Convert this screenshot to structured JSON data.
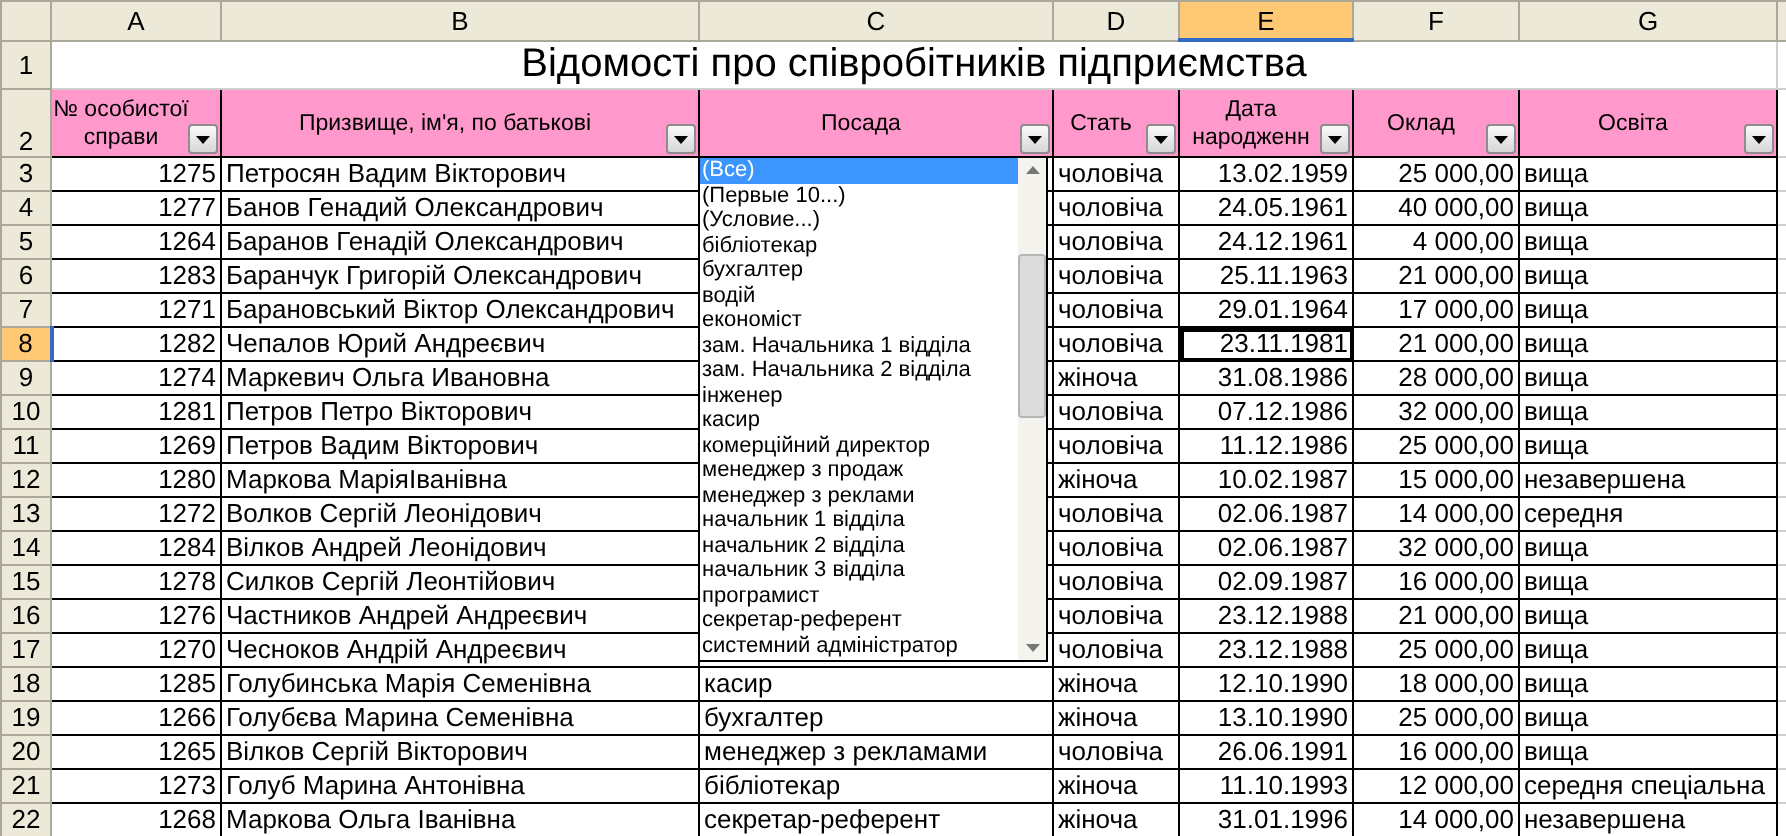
{
  "sheet": {
    "columns": [
      {
        "letter": "A",
        "selected": false
      },
      {
        "letter": "B",
        "selected": false
      },
      {
        "letter": "C",
        "selected": false
      },
      {
        "letter": "D",
        "selected": false
      },
      {
        "letter": "E",
        "selected": true
      },
      {
        "letter": "F",
        "selected": false
      },
      {
        "letter": "G",
        "selected": false
      }
    ],
    "title_row": {
      "number": "1",
      "title": "Відомості про співробітників підприємства"
    },
    "header_row": {
      "number": "2",
      "headers": [
        "№ особистої справи",
        "Призвище, ім'я, по батькові",
        "Посада",
        "Стать",
        "Дата народженн",
        "Оклад",
        "Освіта"
      ]
    },
    "rows": [
      {
        "number": "3",
        "selected": false,
        "id": "1275",
        "name": "Петросян Вадим Вікторович",
        "gender": "чоловіча",
        "birth_date": "13.02.1959",
        "salary": "25 000,00",
        "education": "вища"
      },
      {
        "number": "4",
        "selected": false,
        "id": "1277",
        "name": "Банов Генадий Олександрович",
        "gender": "чоловіча",
        "birth_date": "24.05.1961",
        "salary": "40 000,00",
        "education": "вища"
      },
      {
        "number": "5",
        "selected": false,
        "id": "1264",
        "name": "Баранов Генадій Олександрович",
        "gender": "чоловіча",
        "birth_date": "24.12.1961",
        "salary": "4 000,00",
        "education": "вища"
      },
      {
        "number": "6",
        "selected": false,
        "id": "1283",
        "name": "Баранчук Григорій Олександрович",
        "gender": "чоловіча",
        "birth_date": "25.11.1963",
        "salary": "21 000,00",
        "education": "вища"
      },
      {
        "number": "7",
        "selected": false,
        "id": "1271",
        "name": "Барановський Віктор Олександрович",
        "gender": "чоловіча",
        "birth_date": "29.01.1964",
        "salary": "17 000,00",
        "education": "вища"
      },
      {
        "number": "8",
        "selected": true,
        "id": "1282",
        "name": "Чепалов Юрий Андреєвич",
        "gender": "чоловіча",
        "birth_date": "23.11.1981",
        "salary": "21 000,00",
        "education": "вища"
      },
      {
        "number": "9",
        "selected": false,
        "id": "1274",
        "name": "Маркевич Ольга Ивановна",
        "gender": "жіноча",
        "birth_date": "31.08.1986",
        "salary": "28 000,00",
        "education": "вища"
      },
      {
        "number": "10",
        "selected": false,
        "id": "1281",
        "name": "Петров Петро Вікторович",
        "gender": "чоловіча",
        "birth_date": "07.12.1986",
        "salary": "32 000,00",
        "education": "вища"
      },
      {
        "number": "11",
        "selected": false,
        "id": "1269",
        "name": "Петров Вадим Вікторович",
        "gender": "чоловіча",
        "birth_date": "11.12.1986",
        "salary": "25 000,00",
        "education": "вища"
      },
      {
        "number": "12",
        "selected": false,
        "id": "1280",
        "name": "Маркова МаріяІванівна",
        "gender": "жіноча",
        "birth_date": "10.02.1987",
        "salary": "15 000,00",
        "education": "незавершена"
      },
      {
        "number": "13",
        "selected": false,
        "id": "1272",
        "name": "Волков Сергій Леонідович",
        "gender": "чоловіча",
        "birth_date": "02.06.1987",
        "salary": "14 000,00",
        "education": "середня"
      },
      {
        "number": "14",
        "selected": false,
        "id": "1284",
        "name": "Вілков Андрей Леонідович",
        "gender": "чоловіча",
        "birth_date": "02.06.1987",
        "salary": "32 000,00",
        "education": "вища"
      },
      {
        "number": "15",
        "selected": false,
        "id": "1278",
        "name": "Силков Сергій Леонтійович",
        "gender": "чоловіча",
        "birth_date": "02.09.1987",
        "salary": "16 000,00",
        "education": "вища"
      },
      {
        "number": "16",
        "selected": false,
        "id": "1276",
        "name": "Частников Андрей Андреєвич",
        "gender": "чоловіча",
        "birth_date": "23.12.1988",
        "salary": "21 000,00",
        "education": "вища"
      },
      {
        "number": "17",
        "selected": false,
        "id": "1270",
        "name": "Чесноков Андрій Андреєвич",
        "gender": "чоловіча",
        "birth_date": "23.12.1988",
        "salary": "25 000,00",
        "education": "вища"
      },
      {
        "number": "18",
        "selected": false,
        "id": "1285",
        "name": "Голубинська Марія Семенівна",
        "position": "касир",
        "gender": "жіноча",
        "birth_date": "12.10.1990",
        "salary": "18 000,00",
        "education": "вища"
      },
      {
        "number": "19",
        "selected": false,
        "id": "1266",
        "name": "Голубєва Марина Семенівна",
        "position": "бухгалтер",
        "gender": "жіноча",
        "birth_date": "13.10.1990",
        "salary": "25 000,00",
        "education": "вища"
      },
      {
        "number": "20",
        "selected": false,
        "id": "1265",
        "name": "Вілков Сергій Вікторович",
        "position": "менеджер з рекламами",
        "gender": "чоловіча",
        "birth_date": "26.06.1991",
        "salary": "16 000,00",
        "education": "вища"
      },
      {
        "number": "21",
        "selected": false,
        "id": "1273",
        "name": "Голуб Марина Антонівна",
        "position": "бібліотекар",
        "gender": "жіноча",
        "birth_date": "11.10.1993",
        "salary": "12 000,00",
        "education": "середня спеціальна"
      },
      {
        "number": "22",
        "selected": false,
        "id": "1268",
        "name": "Маркова Ольга Іванівна",
        "position": "секретар-референт",
        "gender": "жіноча",
        "birth_date": "31.01.1996",
        "salary": "14 000,00",
        "education": "незавершена"
      }
    ]
  },
  "filter_dropdown": {
    "items": [
      {
        "label": "(Все)",
        "selected": true
      },
      {
        "label": "(Первые 10...)",
        "selected": false
      },
      {
        "label": "(Условие...)",
        "selected": false
      },
      {
        "label": "бібліотекар",
        "selected": false
      },
      {
        "label": "бухгалтер",
        "selected": false
      },
      {
        "label": "водій",
        "selected": false
      },
      {
        "label": "економіст",
        "selected": false
      },
      {
        "label": "зам. Начальника 1 відділа",
        "selected": false
      },
      {
        "label": "зам. Начальника 2 відділа",
        "selected": false
      },
      {
        "label": "інженер",
        "selected": false
      },
      {
        "label": "касир",
        "selected": false
      },
      {
        "label": "комерційний директор",
        "selected": false
      },
      {
        "label": "менеджер з продаж",
        "selected": false
      },
      {
        "label": "менеджер з реклами",
        "selected": false
      },
      {
        "label": "начальник 1 відділа",
        "selected": false
      },
      {
        "label": "начальник 2 відділа",
        "selected": false
      },
      {
        "label": "начальник 3 відділа",
        "selected": false
      },
      {
        "label": "програмист",
        "selected": false
      },
      {
        "label": "секретар-референт",
        "selected": false
      },
      {
        "label": "системний адміністратор",
        "selected": false
      }
    ]
  }
}
